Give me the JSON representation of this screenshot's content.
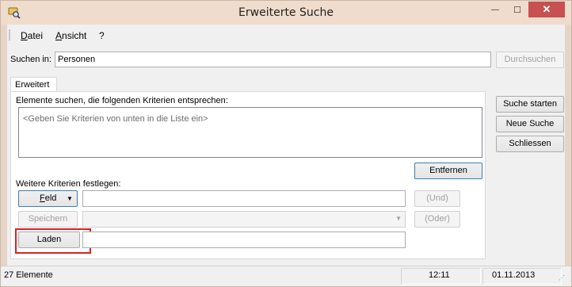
{
  "window": {
    "title": "Erweiterte Suche",
    "close_glyph": "✕",
    "min_glyph": "—",
    "max_glyph": "☐"
  },
  "menu": {
    "items": [
      {
        "accel": "D",
        "rest": "atei"
      },
      {
        "accel": "A",
        "rest": "nsicht"
      },
      {
        "accel": "",
        "rest": "?"
      }
    ]
  },
  "search_in": {
    "label": "Suchen in:",
    "value": "Personen",
    "browse_label": "Durchsuchen"
  },
  "tabs": [
    {
      "label": "Erweitert"
    }
  ],
  "criteria": {
    "heading": "Elemente suchen, die folgenden Kriterien entsprechen:",
    "placeholder": "<Geben Sie Kriterien von unten in die Liste ein>",
    "remove_label": "Entfernen"
  },
  "more_criteria": {
    "heading": "Weitere Kriterien festlegen:",
    "field_label": "Feld",
    "field_accel": "F",
    "field_rest": "eld",
    "field_value": "",
    "and_label": "(Und)",
    "save_label": "Speichern",
    "or_label": "(Oder)",
    "load_label": "Laden",
    "load_value": ""
  },
  "actions": {
    "start_label": "Suche starten",
    "new_label": "Neue Suche",
    "close_label": "Schliessen"
  },
  "status": {
    "count": "27 Elemente",
    "time": "12:11",
    "date": "01.11.2013"
  },
  "colors": {
    "highlight": "#e02020",
    "close_button": "#c75050",
    "title_bg": "#f0dccc"
  },
  "icons": {
    "app": "search-app-icon",
    "dropdown": "chevron-down-icon"
  }
}
